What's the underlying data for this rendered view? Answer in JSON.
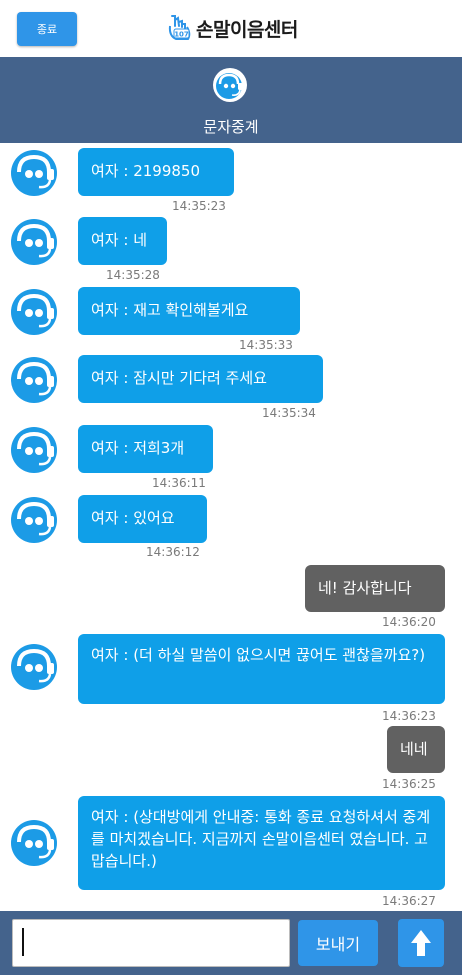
{
  "topbar": {
    "end_label": "종료",
    "brand": "손말이음센터",
    "brand_badge": "107"
  },
  "header": {
    "title": "문자중계"
  },
  "messages": [
    {
      "side": "in",
      "text": "여자 :  2199850",
      "time": "14:35:23"
    },
    {
      "side": "in",
      "text": "여자 : 네",
      "time": "14:35:28"
    },
    {
      "side": "in",
      "text": "여자 : 재고 확인해볼게요",
      "time": "14:35:33"
    },
    {
      "side": "in",
      "text": "여자 : 잠시만 기다려 주세요",
      "time": "14:35:34"
    },
    {
      "side": "in",
      "text": "여자 : 저희3개",
      "time": "14:36:11"
    },
    {
      "side": "in",
      "text": "여자 : 있어요",
      "time": "14:36:12"
    },
    {
      "side": "out",
      "text": "네! 감사합니다",
      "time": "14:36:20"
    },
    {
      "side": "in",
      "text": "여자 : (더 하실 말씀이 없으시면 끊어도 괜찮을까요?)",
      "time": "14:36:23"
    },
    {
      "side": "out",
      "text": "네네",
      "time": "14:36:25"
    },
    {
      "side": "in",
      "text": "여자 : (상대방에게 안내중: 통화 종료 요청하셔서 중계를 마치겠습니다. 지금까지 손말이음센터 였습니다. 고맙습니다.)",
      "time": "14:36:27"
    }
  ],
  "input": {
    "value": "",
    "placeholder": ""
  },
  "send_label": "보내기",
  "colors": {
    "header": "#44638c",
    "incoming": "#0f9fe8",
    "outgoing": "#616161",
    "button": "#2f95e8"
  }
}
